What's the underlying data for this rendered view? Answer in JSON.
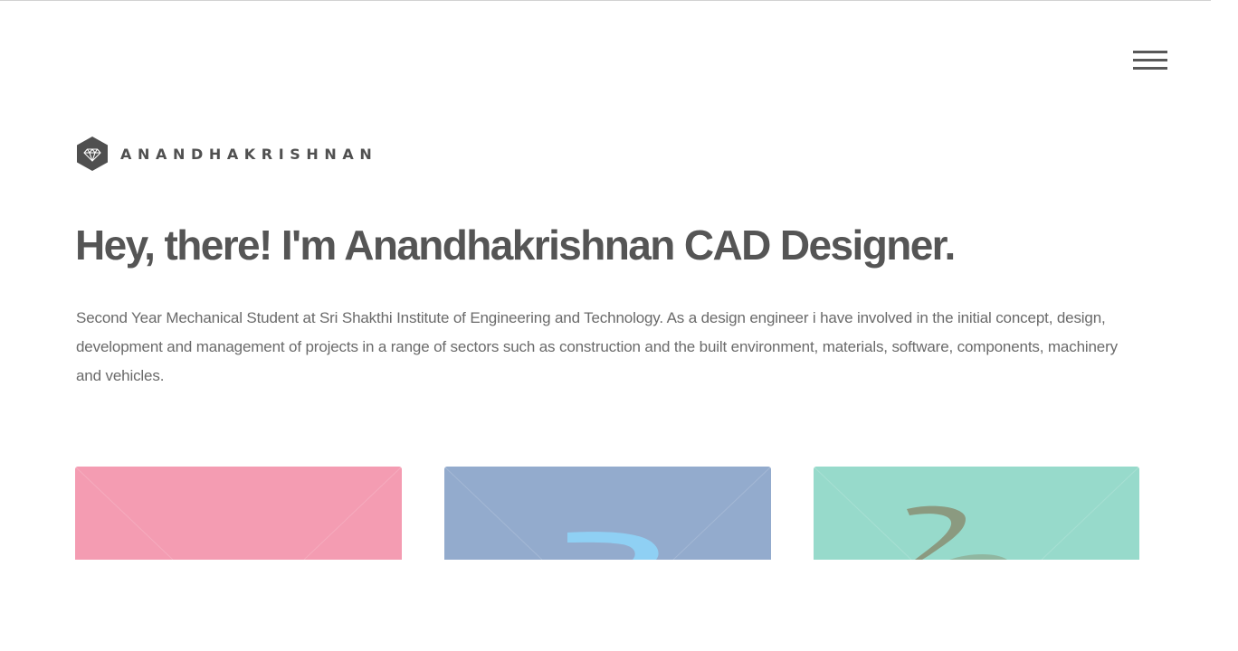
{
  "header": {
    "brand_name": "ANANDHAKRISHNAN",
    "brand_icon": "diamond-hexagon-icon",
    "menu_icon": "hamburger-menu-icon"
  },
  "hero": {
    "title": "Hey, there! I'm Anandhakrishnan CAD Designer.",
    "description": "Second Year Mechanical Student at Sri Shakthi Institute of Engineering and Technology. As a design engineer i have involved in the initial concept, design, development and management of projects in a range of sectors such as construction and the built environment, materials, software, components, machinery and vehicles."
  },
  "tiles": [
    {
      "color": "#f49cb2"
    },
    {
      "color": "#93abcd",
      "accent": "#8fd0f4"
    },
    {
      "color": "#97dacb",
      "accent": "#8b9a80"
    }
  ],
  "colors": {
    "text_dark": "#555555",
    "text_body": "#6a6a6a",
    "background": "#ffffff"
  }
}
